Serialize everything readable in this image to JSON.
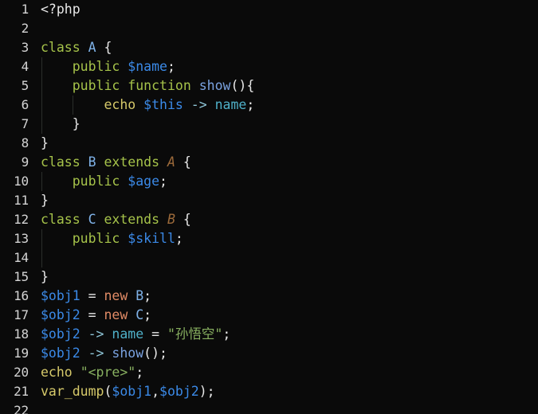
{
  "editor": {
    "language": "php",
    "theme": "dark",
    "active_line": 1,
    "gutter": {
      "line_numbers": [
        "1",
        "2",
        "3",
        "4",
        "5",
        "6",
        "7",
        "8",
        "9",
        "10",
        "11",
        "12",
        "13",
        "14",
        "15",
        "16",
        "17",
        "18",
        "19",
        "20",
        "21",
        "22"
      ]
    },
    "colors": {
      "background": "#0a0a0a",
      "gutter_background": "#0a0a0a",
      "active_line_gutter": "#1f2022",
      "line_number": "#d4d4d4",
      "indent_guide": "#2b2e2b",
      "plain_text": "#e8e8e8",
      "keyword": "#a6c34a",
      "variable": "#3b8ae8",
      "function_name": "#7aa2e0",
      "class_name": "#7fb2e8",
      "parent_class": "#9c6a3a",
      "new_operator": "#e08a65",
      "echo_keyword": "#d6c96a",
      "property": "#4fb0c8",
      "arrow_operator": "#8fc6d8",
      "string": "#88b060"
    },
    "lines": [
      {
        "n": "1",
        "indent": 0,
        "tokens": [
          {
            "t": "<?php",
            "c": "t-plain"
          }
        ]
      },
      {
        "n": "2",
        "indent": 0,
        "tokens": []
      },
      {
        "n": "3",
        "indent": 0,
        "tokens": [
          {
            "t": "class",
            "c": "t-kw"
          },
          {
            "t": " ",
            "c": "t-plain"
          },
          {
            "t": "A",
            "c": "t-cls"
          },
          {
            "t": " ",
            "c": "t-plain"
          },
          {
            "t": "{",
            "c": "t-punct"
          }
        ]
      },
      {
        "n": "4",
        "indent": 1,
        "tokens": [
          {
            "t": "    ",
            "c": "t-plain"
          },
          {
            "t": "public",
            "c": "t-kw"
          },
          {
            "t": " ",
            "c": "t-plain"
          },
          {
            "t": "$name",
            "c": "t-var"
          },
          {
            "t": ";",
            "c": "t-punct"
          }
        ]
      },
      {
        "n": "5",
        "indent": 1,
        "tokens": [
          {
            "t": "    ",
            "c": "t-plain"
          },
          {
            "t": "public",
            "c": "t-kw"
          },
          {
            "t": " ",
            "c": "t-plain"
          },
          {
            "t": "function",
            "c": "t-kw"
          },
          {
            "t": " ",
            "c": "t-plain"
          },
          {
            "t": "show",
            "c": "t-fn"
          },
          {
            "t": "(){",
            "c": "t-punct"
          }
        ]
      },
      {
        "n": "6",
        "indent": 2,
        "tokens": [
          {
            "t": "        ",
            "c": "t-plain"
          },
          {
            "t": "echo",
            "c": "t-echo"
          },
          {
            "t": " ",
            "c": "t-plain"
          },
          {
            "t": "$this",
            "c": "t-var"
          },
          {
            "t": " ",
            "c": "t-plain"
          },
          {
            "t": "->",
            "c": "t-arrow"
          },
          {
            "t": " ",
            "c": "t-plain"
          },
          {
            "t": "name",
            "c": "t-prop"
          },
          {
            "t": ";",
            "c": "t-punct"
          }
        ]
      },
      {
        "n": "7",
        "indent": 1,
        "tokens": [
          {
            "t": "    ",
            "c": "t-plain"
          },
          {
            "t": "}",
            "c": "t-punct"
          }
        ]
      },
      {
        "n": "8",
        "indent": 0,
        "tokens": [
          {
            "t": "}",
            "c": "t-punct"
          }
        ]
      },
      {
        "n": "9",
        "indent": 0,
        "tokens": [
          {
            "t": "class",
            "c": "t-kw"
          },
          {
            "t": " ",
            "c": "t-plain"
          },
          {
            "t": "B",
            "c": "t-cls"
          },
          {
            "t": " ",
            "c": "t-plain"
          },
          {
            "t": "extends",
            "c": "t-kw"
          },
          {
            "t": " ",
            "c": "t-plain"
          },
          {
            "t": "A",
            "c": "t-parent"
          },
          {
            "t": " ",
            "c": "t-plain"
          },
          {
            "t": "{",
            "c": "t-punct"
          }
        ]
      },
      {
        "n": "10",
        "indent": 1,
        "tokens": [
          {
            "t": "    ",
            "c": "t-plain"
          },
          {
            "t": "public",
            "c": "t-kw"
          },
          {
            "t": " ",
            "c": "t-plain"
          },
          {
            "t": "$age",
            "c": "t-var"
          },
          {
            "t": ";",
            "c": "t-punct"
          }
        ]
      },
      {
        "n": "11",
        "indent": 0,
        "tokens": [
          {
            "t": "}",
            "c": "t-punct"
          }
        ]
      },
      {
        "n": "12",
        "indent": 0,
        "tokens": [
          {
            "t": "class",
            "c": "t-kw"
          },
          {
            "t": " ",
            "c": "t-plain"
          },
          {
            "t": "C",
            "c": "t-cls"
          },
          {
            "t": " ",
            "c": "t-plain"
          },
          {
            "t": "extends",
            "c": "t-kw"
          },
          {
            "t": " ",
            "c": "t-plain"
          },
          {
            "t": "B",
            "c": "t-parent"
          },
          {
            "t": " ",
            "c": "t-plain"
          },
          {
            "t": "{",
            "c": "t-punct"
          }
        ]
      },
      {
        "n": "13",
        "indent": 1,
        "tokens": [
          {
            "t": "    ",
            "c": "t-plain"
          },
          {
            "t": "public",
            "c": "t-kw"
          },
          {
            "t": " ",
            "c": "t-plain"
          },
          {
            "t": "$skill",
            "c": "t-var"
          },
          {
            "t": ";",
            "c": "t-punct"
          }
        ]
      },
      {
        "n": "14",
        "indent": 1,
        "tokens": []
      },
      {
        "n": "15",
        "indent": 0,
        "tokens": [
          {
            "t": "}",
            "c": "t-punct"
          }
        ]
      },
      {
        "n": "16",
        "indent": 0,
        "tokens": [
          {
            "t": "$obj1",
            "c": "t-var"
          },
          {
            "t": " = ",
            "c": "t-punct"
          },
          {
            "t": "new",
            "c": "t-new"
          },
          {
            "t": " ",
            "c": "t-plain"
          },
          {
            "t": "B",
            "c": "t-cls"
          },
          {
            "t": ";",
            "c": "t-punct"
          }
        ]
      },
      {
        "n": "17",
        "indent": 0,
        "tokens": [
          {
            "t": "$obj2",
            "c": "t-var"
          },
          {
            "t": " = ",
            "c": "t-punct"
          },
          {
            "t": "new",
            "c": "t-new"
          },
          {
            "t": " ",
            "c": "t-plain"
          },
          {
            "t": "C",
            "c": "t-cls"
          },
          {
            "t": ";",
            "c": "t-punct"
          }
        ]
      },
      {
        "n": "18",
        "indent": 0,
        "tokens": [
          {
            "t": "$obj2",
            "c": "t-var"
          },
          {
            "t": " ",
            "c": "t-plain"
          },
          {
            "t": "->",
            "c": "t-arrow"
          },
          {
            "t": " ",
            "c": "t-plain"
          },
          {
            "t": "name",
            "c": "t-prop"
          },
          {
            "t": " = ",
            "c": "t-punct"
          },
          {
            "t": "\"孙悟空\"",
            "c": "t-str"
          },
          {
            "t": ";",
            "c": "t-punct"
          }
        ]
      },
      {
        "n": "19",
        "indent": 0,
        "tokens": [
          {
            "t": "$obj2",
            "c": "t-var"
          },
          {
            "t": " ",
            "c": "t-plain"
          },
          {
            "t": "->",
            "c": "t-arrow"
          },
          {
            "t": " ",
            "c": "t-plain"
          },
          {
            "t": "show",
            "c": "t-fn"
          },
          {
            "t": "();",
            "c": "t-punct"
          }
        ]
      },
      {
        "n": "20",
        "indent": 0,
        "tokens": [
          {
            "t": "echo",
            "c": "t-echo"
          },
          {
            "t": " ",
            "c": "t-plain"
          },
          {
            "t": "\"<pre>\"",
            "c": "t-str"
          },
          {
            "t": ";",
            "c": "t-punct"
          }
        ]
      },
      {
        "n": "21",
        "indent": 0,
        "tokens": [
          {
            "t": "var_dump",
            "c": "t-echo"
          },
          {
            "t": "(",
            "c": "t-punct"
          },
          {
            "t": "$obj1",
            "c": "t-var"
          },
          {
            "t": ",",
            "c": "t-punct"
          },
          {
            "t": "$obj2",
            "c": "t-var"
          },
          {
            "t": ");",
            "c": "t-punct"
          }
        ]
      },
      {
        "n": "22",
        "indent": 0,
        "tokens": []
      }
    ],
    "indent_guides": [
      {
        "col": 1,
        "from_line": 4,
        "to_line": 7
      },
      {
        "col": 2,
        "from_line": 6,
        "to_line": 6
      },
      {
        "col": 1,
        "from_line": 10,
        "to_line": 10
      },
      {
        "col": 1,
        "from_line": 13,
        "to_line": 14
      }
    ]
  }
}
